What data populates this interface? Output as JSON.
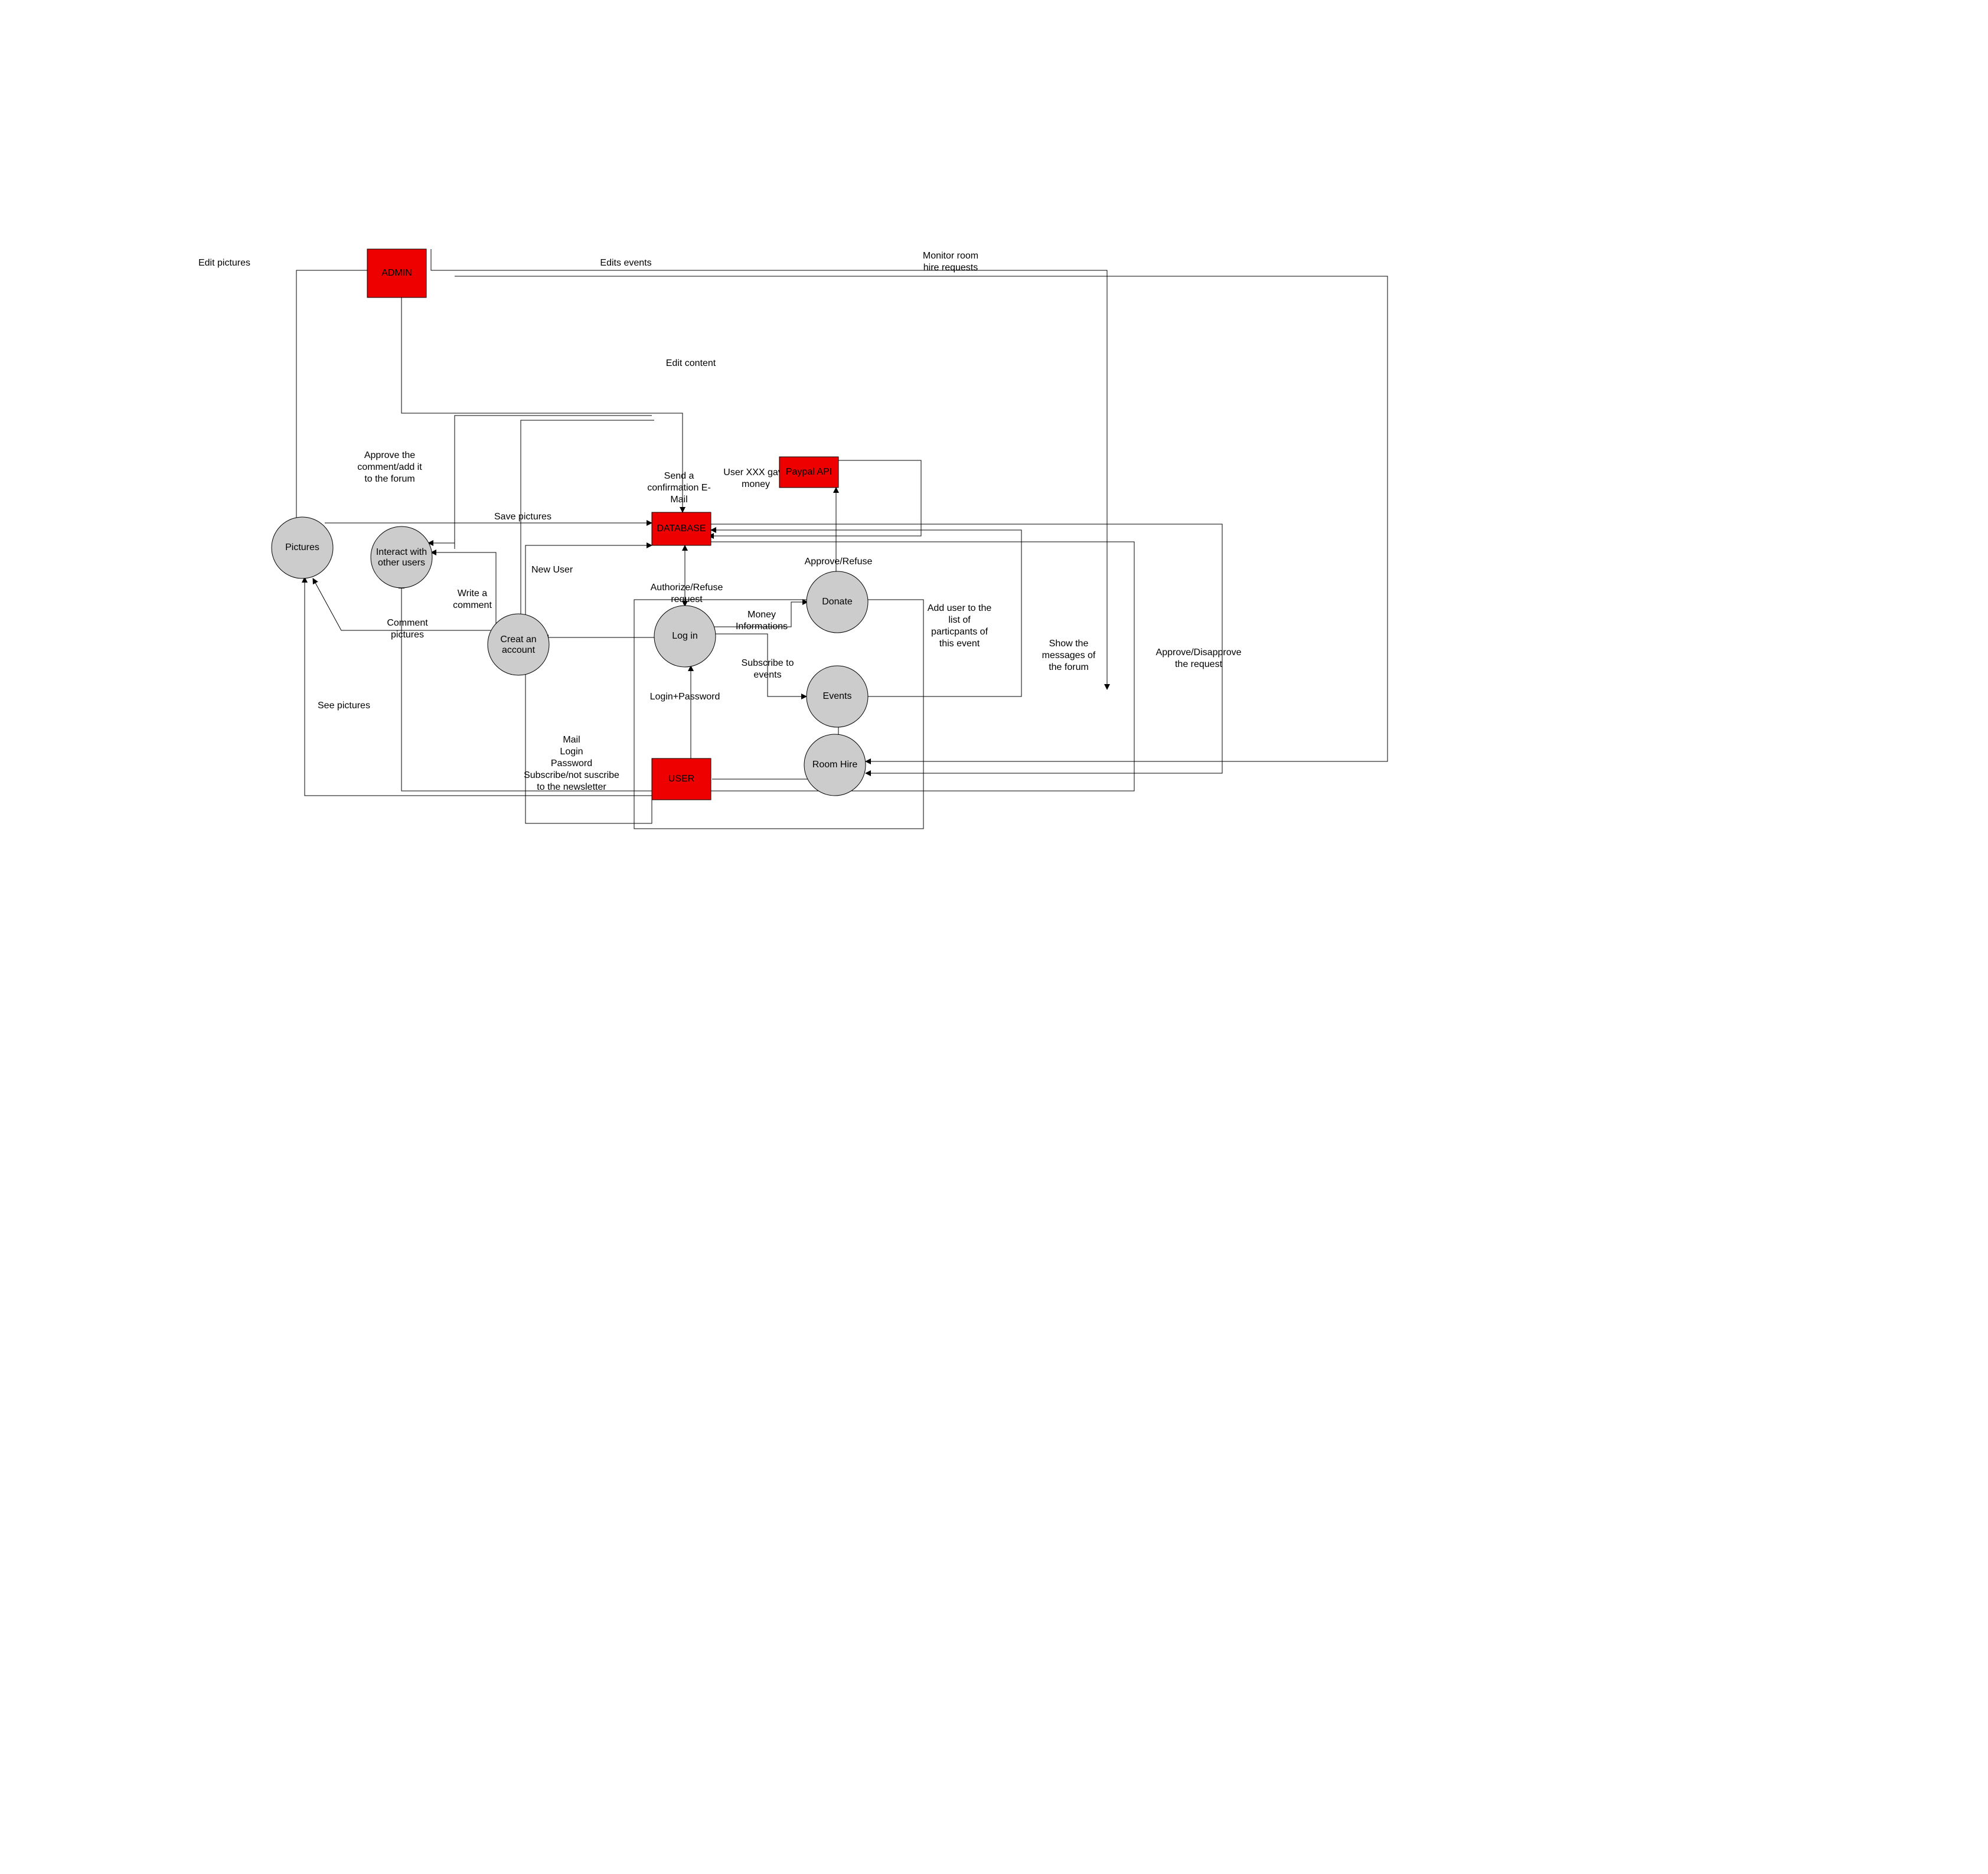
{
  "nodes": {
    "admin": {
      "label": "ADMIN"
    },
    "paypal": {
      "label": "Paypal API"
    },
    "database": {
      "label": "DATABASE"
    },
    "user": {
      "label": "USER"
    },
    "pictures": {
      "label": "Pictures"
    },
    "interact": {
      "label1": "Interact with",
      "label2": "other users"
    },
    "create": {
      "label1": "Creat an",
      "label2": "account"
    },
    "login": {
      "label": "Log in"
    },
    "donate": {
      "label": "Donate"
    },
    "events": {
      "label": "Events"
    },
    "roomhire": {
      "label": "Room Hire"
    }
  },
  "edges": {
    "editPictures": {
      "label": "Edit pictures"
    },
    "editsEvents": {
      "label": "Edits events"
    },
    "monitorRoom": {
      "l1": "Monitor room",
      "l2": "hire requests"
    },
    "editContent": {
      "label": "Edit content"
    },
    "approveComment": {
      "l1": "Approve the",
      "l2": "comment/add it",
      "l3": "to the forum"
    },
    "sendConf": {
      "l1": "Send a",
      "l2": "confirmation E-",
      "l3": "Mail"
    },
    "userGaveMoney": {
      "l1": "User XXX gave",
      "l2": "money"
    },
    "savePictures": {
      "label": "Save pictures"
    },
    "approveRefuse": {
      "label": "Approve/Refuse"
    },
    "newUser": {
      "label": "New User"
    },
    "writeComment": {
      "l1": "Write a",
      "l2": "comment"
    },
    "authorizeReq": {
      "l1": "Authorize/Refuse",
      "l2": "request"
    },
    "moneyInfo": {
      "l1": "Money",
      "l2": "Informations"
    },
    "commentPictures": {
      "l1": "Comment",
      "l2": "pictures"
    },
    "addUser": {
      "l1": "Add user to the",
      "l2": "list of",
      "l3": "particpants of",
      "l4": "this event"
    },
    "showMessages": {
      "l1": "Show the",
      "l2": "messages of",
      "l3": "the forum"
    },
    "approveDisReq": {
      "l1": "Approve/Disapprove",
      "l2": "the request"
    },
    "subscribeEvents": {
      "l1": "Subscribe to",
      "l2": "events"
    },
    "loginPassword": {
      "label": "Login+Password"
    },
    "seePictures": {
      "label": "See pictures"
    },
    "accountDetails": {
      "l1": "Mail",
      "l2": "Login",
      "l3": "Password",
      "l4": "Subscribe/not suscribe",
      "l5": "to the newsletter"
    }
  }
}
